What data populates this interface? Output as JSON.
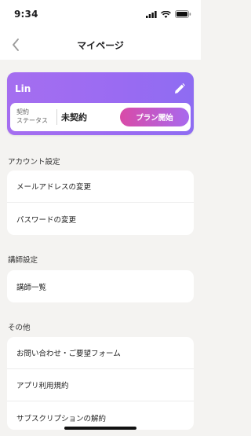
{
  "status_bar": {
    "time": "9:34"
  },
  "nav": {
    "title": "マイページ"
  },
  "profile": {
    "name": "Lin",
    "contract_label_line1": "契約",
    "contract_label_line2": "ステータス",
    "contract_status": "未契約",
    "plan_button": "プラン開始"
  },
  "sections": {
    "account": {
      "header": "アカウント設定",
      "items": [
        "メールアドレスの変更",
        "パスワードの変更"
      ]
    },
    "instructor": {
      "header": "講師設定",
      "items": [
        "講師一覧"
      ]
    },
    "other": {
      "header": "その他",
      "items": [
        "お問い合わせ・ご要望フォーム",
        "アプリ利用規約",
        "サブスクリプションの解約"
      ]
    }
  },
  "colors": {
    "card_gradient_start": "#a56ef0",
    "button_gradient_start": "#d94aa7",
    "button_gradient_end": "#a869ee",
    "background": "#f4f3f1"
  }
}
